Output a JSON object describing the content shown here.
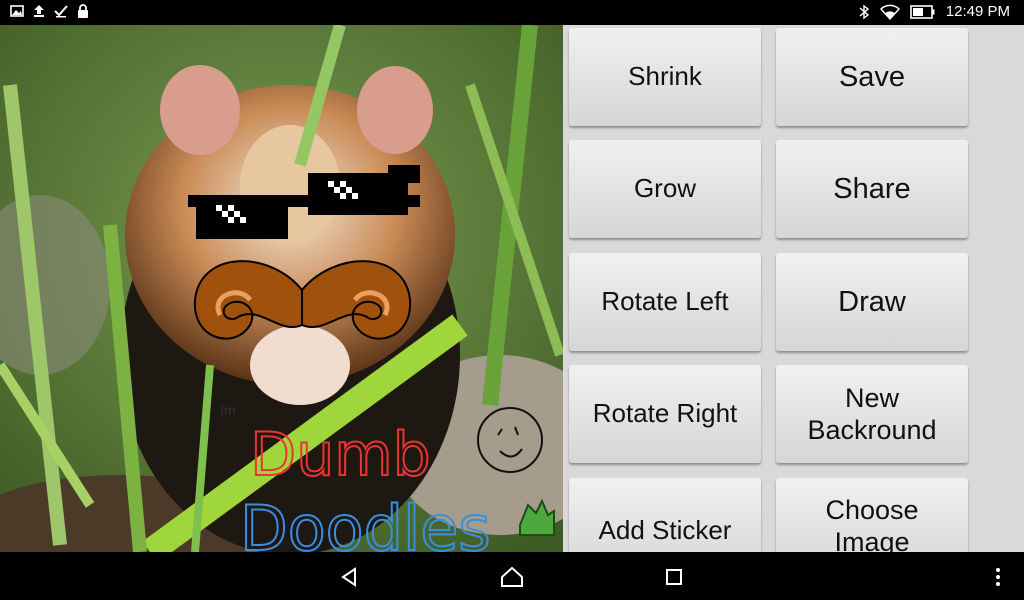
{
  "status_bar": {
    "time": "12:49 PM",
    "icons_left": [
      "image-icon",
      "upload-icon",
      "checkmark-icon",
      "lock-icon"
    ],
    "icons_right": [
      "bluetooth-icon",
      "wifi-icon",
      "battery-icon"
    ]
  },
  "canvas": {
    "sticker_texts": [
      "Dumb",
      "Doodles"
    ],
    "small_scribble": "Im"
  },
  "buttons": {
    "shrink": "Shrink",
    "save": "Save",
    "grow": "Grow",
    "share": "Share",
    "rotate_left": "Rotate Left",
    "draw": "Draw",
    "rotate_right": "Rotate Right",
    "new_background": "New Backround",
    "add_sticker": "Add Sticker",
    "choose_image": "Choose Image"
  },
  "nav_bar": {
    "icons": [
      "back-icon",
      "home-icon",
      "recents-icon",
      "overflow-menu-icon"
    ]
  },
  "colors": {
    "panel_bg": "#d9d9d9",
    "button_top": "#f0f0f0",
    "button_bottom": "#d6d6d6",
    "mustache": "#a0520c"
  }
}
